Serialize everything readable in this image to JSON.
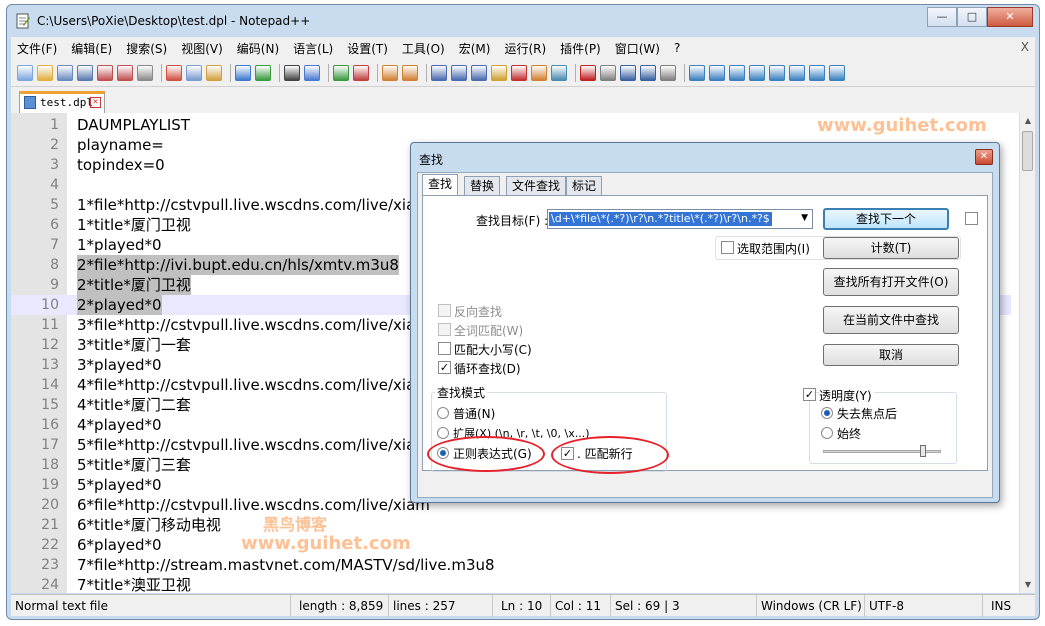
{
  "window": {
    "title": "C:\\Users\\PoXie\\Desktop\\test.dpl - Notepad++"
  },
  "menu": [
    "文件(F)",
    "编辑(E)",
    "搜索(S)",
    "视图(V)",
    "编码(N)",
    "语言(L)",
    "设置(T)",
    "工具(O)",
    "宏(M)",
    "运行(R)",
    "插件(P)",
    "窗口(W)",
    "?"
  ],
  "menu_close": "X",
  "tab": {
    "label": "test.dpl"
  },
  "editor": {
    "lines": [
      {
        "n": "1",
        "t": "DAUMPLAYLIST"
      },
      {
        "n": "2",
        "t": "playname="
      },
      {
        "n": "3",
        "t": "topindex=0"
      },
      {
        "n": "4",
        "t": ""
      },
      {
        "n": "5",
        "t": "1*file*http://cstvpull.live.wscdns.com/live/xiam"
      },
      {
        "n": "6",
        "t": "1*title*厦门卫视"
      },
      {
        "n": "7",
        "t": "1*played*0"
      },
      {
        "n": "8",
        "t": "2*file*http://ivi.bupt.edu.cn/hls/xmtv.m3u8"
      },
      {
        "n": "9",
        "t": "2*title*厦门卫视"
      },
      {
        "n": "10",
        "t": "2*played*0"
      },
      {
        "n": "11",
        "t": "3*file*http://cstvpull.live.wscdns.com/live/xiam"
      },
      {
        "n": "12",
        "t": "3*title*厦门一套"
      },
      {
        "n": "13",
        "t": "3*played*0"
      },
      {
        "n": "14",
        "t": "4*file*http://cstvpull.live.wscdns.com/live/xiam"
      },
      {
        "n": "15",
        "t": "4*title*厦门二套"
      },
      {
        "n": "16",
        "t": "4*played*0"
      },
      {
        "n": "17",
        "t": "5*file*http://cstvpull.live.wscdns.com/live/xiam"
      },
      {
        "n": "18",
        "t": "5*title*厦门三套"
      },
      {
        "n": "19",
        "t": "5*played*0"
      },
      {
        "n": "20",
        "t": "6*file*http://cstvpull.live.wscdns.com/live/xiam"
      },
      {
        "n": "21",
        "t": "6*title*厦门移动电视"
      },
      {
        "n": "22",
        "t": "6*played*0"
      },
      {
        "n": "23",
        "t": "7*file*http://stream.mastvnet.com/MASTV/sd/live.m3u8"
      },
      {
        "n": "24",
        "t": "7*title*澳亚卫视"
      }
    ],
    "highlighted_lines": [
      "8",
      "9",
      "10"
    ],
    "current_line": "10"
  },
  "watermark": {
    "name": "黑鸟博客",
    "url": "www.guihet.com"
  },
  "status": {
    "type": "Normal text file",
    "length": "length : 8,859",
    "lines": "lines : 257",
    "ln": "Ln : 10",
    "col": "Col : 11",
    "sel": "Sel : 69 | 3",
    "eol": "Windows (CR LF)",
    "encoding": "UTF-8",
    "mode": "INS"
  },
  "dialog": {
    "title": "查找",
    "tabs": [
      "查找",
      "替换",
      "文件查找",
      "标记"
    ],
    "find_label": "查找目标(F) :",
    "find_value": "\\d+\\*file\\*(.*?)\\r?\\n.*?title\\*(.*?)\\r?\\n.*?$",
    "in_selection": "选取范围内(I)",
    "backward": "反向查找",
    "whole_word": "全词匹配(W)",
    "match_case": "匹配大小写(C)",
    "wrap": "循环查找(D)",
    "mode_title": "查找模式",
    "mode_normal": "普通(N)",
    "mode_extended": "扩展(X) (\\n, \\r, \\t, \\0, \\x...)",
    "mode_regex": "正则表达式(G)",
    "dot_newline": ". 匹配新行",
    "transparency": "透明度(Y)",
    "on_lose_focus": "失去焦点后",
    "always": "始终",
    "buttons": {
      "find_next": "查找下一个",
      "count": "计数(T)",
      "find_all_open": "查找所有打开文件(O)",
      "find_all_current": "在当前文件中查找",
      "cancel": "取消"
    },
    "state": {
      "match_case": false,
      "wrap": true,
      "mode": "regex",
      "dot_newline": true,
      "transparency": true,
      "transparency_mode": "on_lose_focus",
      "transparency_level": 0.85
    }
  },
  "colors": {
    "accent": "#3375d6",
    "annotation": "#e8202a",
    "watermark": "#ff8c3c"
  }
}
